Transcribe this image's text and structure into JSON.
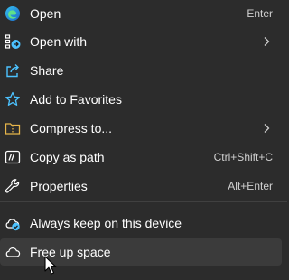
{
  "menu": {
    "items": [
      {
        "label": "Open",
        "shortcut": "Enter",
        "icon": "edge-icon"
      },
      {
        "label": "Open with",
        "shortcut": "",
        "icon": "open-with-icon",
        "submenu": true
      },
      {
        "label": "Share",
        "shortcut": "",
        "icon": "share-icon"
      },
      {
        "label": "Add to Favorites",
        "shortcut": "",
        "icon": "star-icon"
      },
      {
        "label": "Compress to...",
        "shortcut": "",
        "icon": "zip-folder-icon",
        "submenu": true
      },
      {
        "label": "Copy as path",
        "shortcut": "Ctrl+Shift+C",
        "icon": "copy-path-icon"
      },
      {
        "label": "Properties",
        "shortcut": "Alt+Enter",
        "icon": "wrench-icon"
      }
    ],
    "cloud_items": [
      {
        "label": "Always keep on this device",
        "icon": "cloud-check-icon"
      },
      {
        "label": "Free up space",
        "icon": "cloud-icon"
      }
    ]
  },
  "colors": {
    "background": "#2c2c2c",
    "hover": "#3b3b3b",
    "text": "#ffffff",
    "accent": "#4cc2ff"
  }
}
